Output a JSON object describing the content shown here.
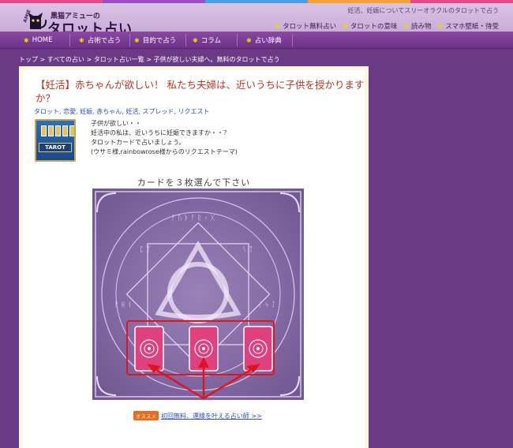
{
  "site": {
    "logo_sub": "黒猫アミューの",
    "logo_main": "タロット占い",
    "logo_amie": "AMIE",
    "tagline": "妊活、妊娠についてスリーオラクルのタロットで占う"
  },
  "header_nav": [
    {
      "label": "タロット無料占い"
    },
    {
      "label": "タロットの意味"
    },
    {
      "label": "読み物"
    },
    {
      "label": "スマホ壁紙・待受"
    }
  ],
  "main_nav": [
    {
      "label": "HOME"
    },
    {
      "label": "占術で占う"
    },
    {
      "label": "目的で占う"
    },
    {
      "label": "コラム"
    },
    {
      "label": "占い辞典"
    }
  ],
  "breadcrumb": "トップ > すべての占い > タロット占い一覧 > 子供が欲しい夫婦へ。無料のタロットで占う",
  "article": {
    "title": "【妊活】赤ちゃんが欲しい！ 私たち夫婦は、近いうちに子供を授かりますか？",
    "tags": "タロット, 恋愛, 妊娠, 赤ちゃん, 妊活, スプレッド, リクエスト",
    "thumb_label": "TAROT",
    "description": [
      "子供が欲しい・・",
      "妊活中の私は、近いうちに妊娠できますか・・？",
      "タロットカードで占いましょう。",
      "(ウサミ様,rainbowrose様からのリクエストテーマ)"
    ],
    "instruction": "カードを３枚選んで下さい"
  },
  "promo": {
    "badge": "オススメ",
    "link": "初回無料、運縁を叶える占い師 >>"
  },
  "colors": {
    "background": "#6a3a85",
    "header": "#d9c3e3",
    "nav": "#7b3f95",
    "title": "#c0341f",
    "tag_link": "#2950c2",
    "card_back": "#e1407f",
    "selection_border": "#e0141f"
  },
  "icons": {
    "nav_bullet": "star-icon",
    "logo": "black-cat-icon"
  }
}
